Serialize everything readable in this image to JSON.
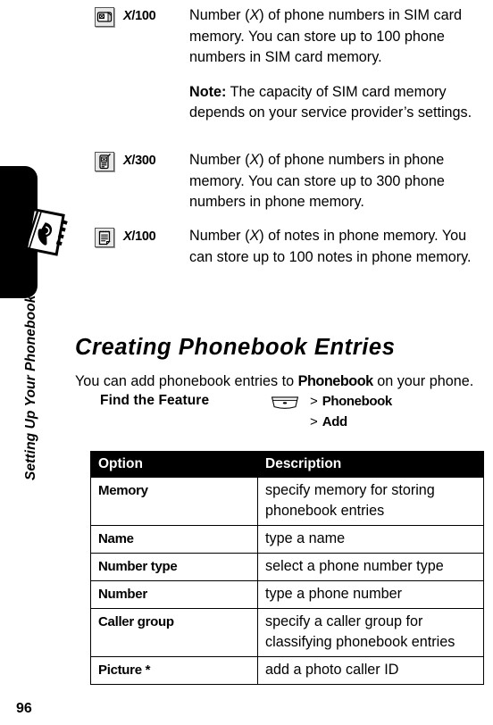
{
  "chapter": {
    "running_title": "Setting Up Your Phonebook",
    "page_number": "96"
  },
  "definitions": [
    {
      "icon": "sim-card-icon",
      "counter_variable": "X",
      "counter_max": "/100",
      "paragraphs": [
        {
          "kind": "body",
          "text_pre": "Number (",
          "text_var": "X",
          "text_post": ") of phone numbers in SIM card memory. You can store up to 100 phone numbers in SIM card memory."
        },
        {
          "kind": "note",
          "lead": "Note:",
          "text": " The capacity of SIM card memory depends on your service provider’s settings."
        }
      ]
    },
    {
      "icon": "phone-handset-icon",
      "counter_variable": "X",
      "counter_max": "/300",
      "paragraphs": [
        {
          "kind": "body",
          "text_pre": "Number (",
          "text_var": "X",
          "text_post": ") of phone numbers in phone memory. You can store up to 300 phone numbers in phone memory."
        }
      ]
    },
    {
      "icon": "notepad-icon",
      "counter_variable": "X",
      "counter_max": "/100",
      "paragraphs": [
        {
          "kind": "body",
          "text_pre": "Number (",
          "text_var": "X",
          "text_post": ") of notes in phone memory. You can store up to 100 notes in phone memory."
        }
      ]
    }
  ],
  "section": {
    "heading": "Creating Phonebook Entries",
    "intro_pre": "You can add phonebook entries to ",
    "intro_term": "Phonebook",
    "intro_post": " on your phone."
  },
  "find_the_feature": {
    "label": "Find the Feature",
    "menu_icon": "menu-key-icon",
    "steps": [
      {
        "chevron": ">",
        "term": "Phonebook"
      },
      {
        "chevron": ">",
        "term": "Add"
      }
    ]
  },
  "options_table": {
    "headers": [
      "Option",
      "Description"
    ],
    "rows": [
      {
        "option": "Memory",
        "description": "specify memory for storing phonebook entries"
      },
      {
        "option": "Name",
        "description": "type a name"
      },
      {
        "option": "Number type",
        "description": "select a phone number type"
      },
      {
        "option": "Number",
        "description": "type a phone number"
      },
      {
        "option": "Caller group",
        "description": "specify a caller group for classifying phonebook entries"
      },
      {
        "option": "Picture *",
        "description": "add a photo caller ID"
      }
    ]
  },
  "colors": {
    "ink": "#000000",
    "paper": "#ffffff",
    "header_bar": "#000000",
    "header_text": "#ffffff",
    "icon_face": "#e8e8e8"
  }
}
